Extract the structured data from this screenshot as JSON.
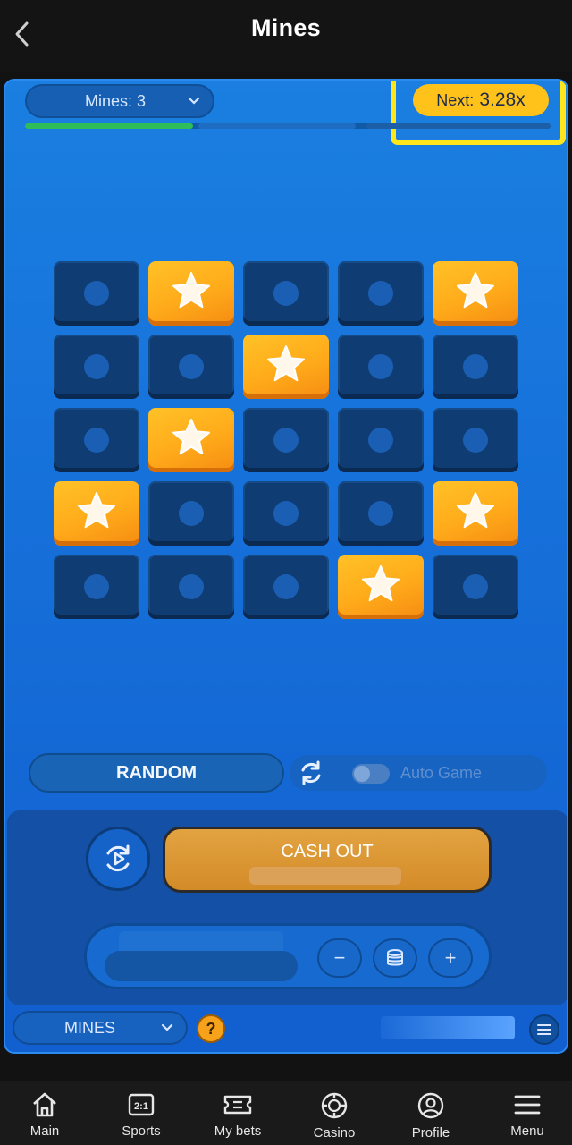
{
  "header": {
    "title": "Mines"
  },
  "game": {
    "mines_select_label": "Mines: 3",
    "next_label": "Next:",
    "next_multiplier": "3.28x",
    "progress_fraction": 0.32,
    "grid": [
      [
        "closed",
        "star",
        "closed",
        "closed",
        "star"
      ],
      [
        "closed",
        "closed",
        "star",
        "closed",
        "closed"
      ],
      [
        "closed",
        "star",
        "closed",
        "closed",
        "closed"
      ],
      [
        "star",
        "closed",
        "closed",
        "closed",
        "star"
      ],
      [
        "closed",
        "closed",
        "closed",
        "star",
        "closed"
      ]
    ],
    "random_label": "RANDOM",
    "auto_game_label": "Auto Game",
    "cashout_label": "CASH OUT",
    "minus_label": "−",
    "plus_label": "+",
    "game_select_label": "MINES",
    "help_label": "?"
  },
  "colors": {
    "star_tile": "#ffb01f",
    "closed_tile": "#0f3c72",
    "accent": "#ffc21a",
    "highlight": "#ffe61a"
  },
  "nav": [
    {
      "label": "Main",
      "icon": "home-icon"
    },
    {
      "label": "Sports",
      "icon": "odds-icon"
    },
    {
      "label": "My bets",
      "icon": "ticket-icon"
    },
    {
      "label": "Casino",
      "icon": "chip-icon"
    },
    {
      "label": "Profile",
      "icon": "user-icon"
    },
    {
      "label": "Menu",
      "icon": "hamburger-icon"
    }
  ]
}
